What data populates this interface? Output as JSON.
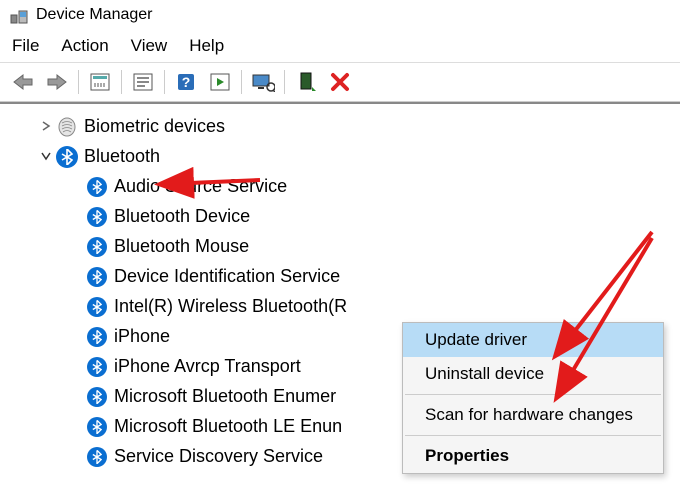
{
  "window": {
    "title": "Device Manager"
  },
  "menu": {
    "file": "File",
    "action": "Action",
    "view": "View",
    "help": "Help"
  },
  "toolbar": {
    "back": "back",
    "forward": "forward",
    "show_hidden": "show-hidden",
    "properties": "properties",
    "help": "help",
    "play": "play",
    "monitor": "monitor",
    "update": "update",
    "delete": "delete"
  },
  "tree": {
    "root_collapsed": {
      "label": "Biometric devices"
    },
    "root_expanded": {
      "label": "Bluetooth"
    },
    "children": [
      {
        "label": "Audio Source Service"
      },
      {
        "label": "Bluetooth Device"
      },
      {
        "label": "Bluetooth Mouse"
      },
      {
        "label": "Device Identification Service"
      },
      {
        "label": "Intel(R) Wireless Bluetooth(R",
        "selected": true
      },
      {
        "label": "iPhone"
      },
      {
        "label": "iPhone Avrcp Transport"
      },
      {
        "label": "Microsoft Bluetooth Enumer"
      },
      {
        "label": "Microsoft Bluetooth LE Enun"
      },
      {
        "label": "Service Discovery Service"
      }
    ]
  },
  "context_menu": {
    "update": "Update driver",
    "uninstall": "Uninstall device",
    "scan": "Scan for hardware changes",
    "properties": "Properties"
  },
  "colors": {
    "bt_blue": "#0a6ed1",
    "highlight": "#b7dcf6",
    "arrow_red": "#e21b1b"
  }
}
